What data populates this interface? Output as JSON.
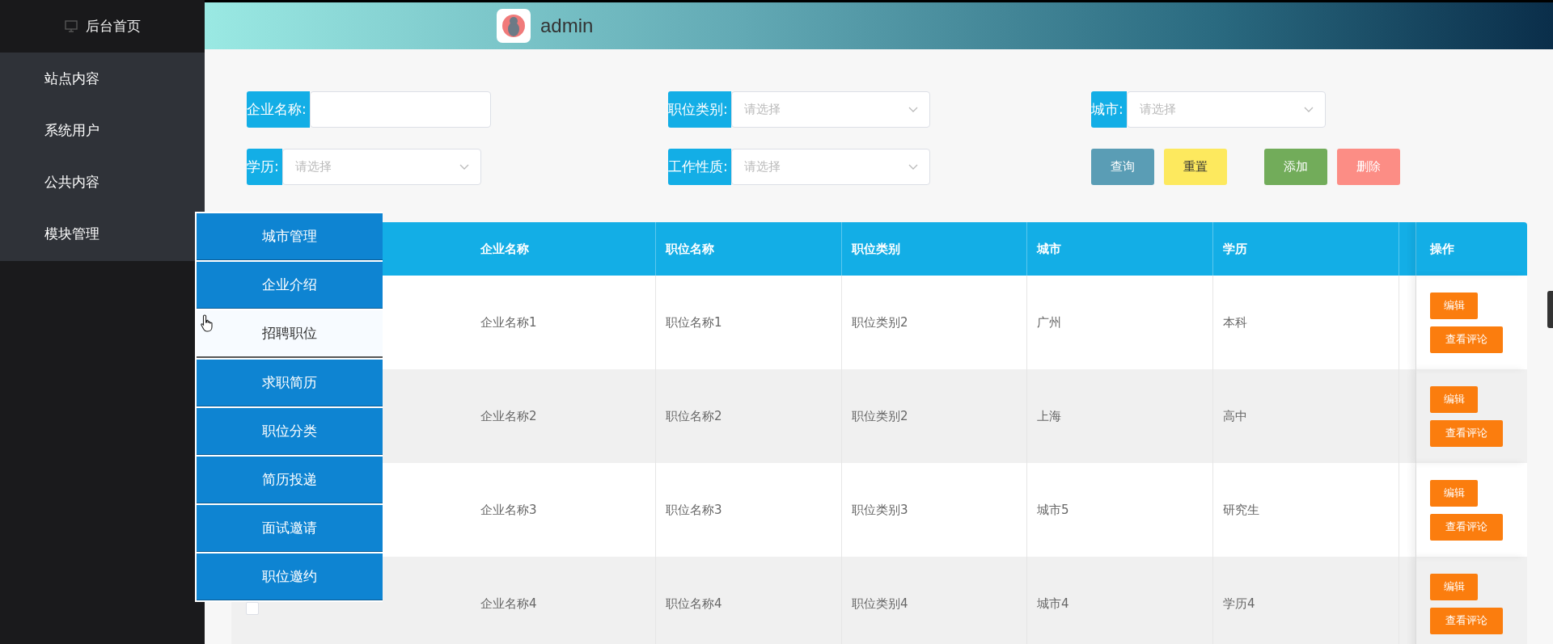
{
  "sidebar": {
    "home": "后台首页",
    "items": [
      {
        "label": "站点内容"
      },
      {
        "label": "系统用户"
      },
      {
        "label": "公共内容"
      },
      {
        "label": "模块管理"
      }
    ]
  },
  "header": {
    "username": "admin"
  },
  "filters": [
    {
      "kind": "input",
      "label": "企业名称:"
    },
    {
      "kind": "select",
      "label": "职位类别:",
      "placeholder": "请选择"
    },
    {
      "kind": "select",
      "label": "城市:",
      "placeholder": "请选择"
    },
    {
      "kind": "select",
      "label": "学历:",
      "placeholder": "请选择"
    },
    {
      "kind": "select",
      "label": "工作性质:",
      "placeholder": "请选择"
    },
    {
      "kind": "buttons"
    }
  ],
  "buttons": [
    {
      "label": "查询",
      "color": "#5a9db5"
    },
    {
      "label": "重置",
      "color": "#fde95e"
    },
    {
      "label": "添加",
      "color": "#72ac5a"
    },
    {
      "label": "删除",
      "color": "#fc8d85"
    }
  ],
  "table": {
    "columns": [
      "企业名称",
      "职位名称",
      "职位类别",
      "城市",
      "学历"
    ],
    "action_column": "操作",
    "rows": [
      {
        "cells": [
          "企业名称1",
          "职位名称1",
          "职位类别2",
          "广州",
          "本科"
        ],
        "actions": [
          "编辑",
          "查看评论"
        ]
      },
      {
        "cells": [
          "企业名称2",
          "职位名称2",
          "职位类别2",
          "上海",
          "高中"
        ],
        "actions": [
          "编辑",
          "查看评论"
        ]
      },
      {
        "cells": [
          "企业名称3",
          "职位名称3",
          "职位类别3",
          "城市5",
          "研究生"
        ],
        "actions": [
          "编辑",
          "查看评论"
        ]
      },
      {
        "checked": false,
        "cells": [
          "企业名称4",
          "职位名称4",
          "职位类别4",
          "城市4",
          "学历4"
        ],
        "actions": [
          "编辑",
          "查看评论"
        ]
      }
    ]
  },
  "menu": {
    "items": [
      {
        "label": "城市管理",
        "selected": false
      },
      {
        "label": "企业介绍",
        "selected": false
      },
      {
        "label": "招聘职位",
        "selected": true
      },
      {
        "label": "求职简历",
        "selected": false
      },
      {
        "label": "职位分类",
        "selected": false
      },
      {
        "label": "简历投递",
        "selected": false
      },
      {
        "label": "面试邀请",
        "selected": false
      },
      {
        "label": "职位邀约",
        "selected": false
      }
    ]
  }
}
